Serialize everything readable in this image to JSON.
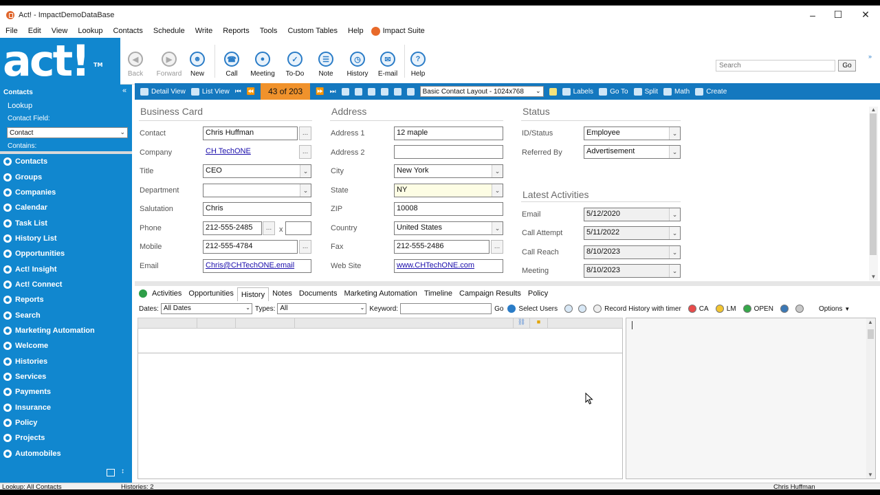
{
  "window": {
    "title": "Act! - ImpactDemoDataBase"
  },
  "menubar": [
    "File",
    "Edit",
    "View",
    "Lookup",
    "Contacts",
    "Schedule",
    "Write",
    "Reports",
    "Tools",
    "Custom Tables",
    "Help"
  ],
  "impact_suite": "Impact Suite",
  "logo": "act!",
  "toolbar": {
    "buttons": [
      {
        "label": "Back",
        "icon": "back-arrow-icon",
        "enabled": false
      },
      {
        "label": "Forward",
        "icon": "forward-arrow-icon",
        "enabled": false
      },
      {
        "label": "New",
        "icon": "new-contact-icon",
        "enabled": true
      },
      {
        "label": "Call",
        "icon": "phone-icon",
        "enabled": true
      },
      {
        "label": "Meeting",
        "icon": "meeting-icon",
        "enabled": true
      },
      {
        "label": "To-Do",
        "icon": "todo-check-icon",
        "enabled": true
      },
      {
        "label": "Note",
        "icon": "note-icon",
        "enabled": true
      },
      {
        "label": "History",
        "icon": "history-clock-icon",
        "enabled": true
      },
      {
        "label": "E-mail",
        "icon": "email-icon",
        "enabled": true
      },
      {
        "label": "Help",
        "icon": "help-question-icon",
        "enabled": true
      }
    ],
    "search_placeholder": "Search",
    "go": "Go"
  },
  "nav": {
    "header": "Contacts",
    "lookup": "Lookup",
    "contact_field_label": "Contact Field:",
    "contact_field_value": "Contact",
    "contains_label": "Contains:",
    "items": [
      "Contacts",
      "Groups",
      "Companies",
      "Calendar",
      "Task List",
      "History List",
      "Opportunities",
      "Act! Insight",
      "Act! Connect",
      "Reports",
      "Search",
      "Marketing Automation",
      "Welcome",
      "Histories",
      "Services",
      "Payments",
      "Insurance",
      "Policy",
      "Projects",
      "Automobiles"
    ]
  },
  "recordbar": {
    "detail_view": "Detail View",
    "list_view": "List View",
    "record_count": "43 of 203",
    "layout": "Basic Contact Layout - 1024x768",
    "labels": "Labels",
    "goto": "Go To",
    "split": "Split",
    "math": "Math",
    "create": "Create"
  },
  "business_card": {
    "title": "Business Card",
    "contact_label": "Contact",
    "contact": "Chris Huffman",
    "company_label": "Company",
    "company": "CH TechONE",
    "title_label": "Title",
    "job_title": "CEO",
    "department_label": "Department",
    "department": "",
    "salutation_label": "Salutation",
    "salutation": "Chris",
    "phone_label": "Phone",
    "phone": "212-555-2485",
    "ext_label": "x",
    "ext": "",
    "mobile_label": "Mobile",
    "mobile": "212-555-4784",
    "email_label": "Email",
    "email": "Chris@CHTechONE.email"
  },
  "address": {
    "title": "Address",
    "address1_label": "Address 1",
    "address1": "12 maple",
    "address2_label": "Address 2",
    "address2": "",
    "city_label": "City",
    "city": "New York",
    "state_label": "State",
    "state": "NY",
    "zip_label": "ZIP",
    "zip": "10008",
    "country_label": "Country",
    "country": "United States",
    "fax_label": "Fax",
    "fax": "212-555-2486",
    "website_label": "Web Site",
    "website": "www.CHTechONE.com"
  },
  "status": {
    "title": "Status",
    "id_status_label": "ID/Status",
    "id_status": "Employee",
    "referred_label": "Referred By",
    "referred": "Advertisement"
  },
  "latest": {
    "title": "Latest Activities",
    "email_label": "Email",
    "email": "5/12/2020",
    "call_attempt_label": "Call Attempt",
    "call_attempt": "5/11/2022",
    "call_reach_label": "Call Reach",
    "call_reach": "8/10/2023",
    "meeting_label": "Meeting",
    "meeting": "8/10/2023"
  },
  "tabs": [
    "Activities",
    "Opportunities",
    "History",
    "Notes",
    "Documents",
    "Marketing Automation",
    "Timeline",
    "Campaign Results",
    "Policy"
  ],
  "active_tab": "History",
  "filter": {
    "dates_label": "Dates:",
    "dates": "All Dates",
    "types_label": "Types:",
    "types": "All",
    "keyword_label": "Keyword:",
    "keyword": "",
    "go": "Go",
    "select_users": "Select Users",
    "record_history": "Record History with timer",
    "ca": "CA",
    "lm": "LM",
    "open": "OPEN",
    "options": "Options"
  },
  "statusbar": {
    "lookup": "Lookup: All Contacts",
    "histories": "Histories: 2",
    "user": "Chris Huffman"
  },
  "colors": {
    "nav_blue": "#1187cf",
    "record_bar": "#1478bf",
    "record_count_bg": "#f0922c",
    "ca": "#e84b4b",
    "lm": "#f2c531",
    "open": "#36a84a"
  }
}
